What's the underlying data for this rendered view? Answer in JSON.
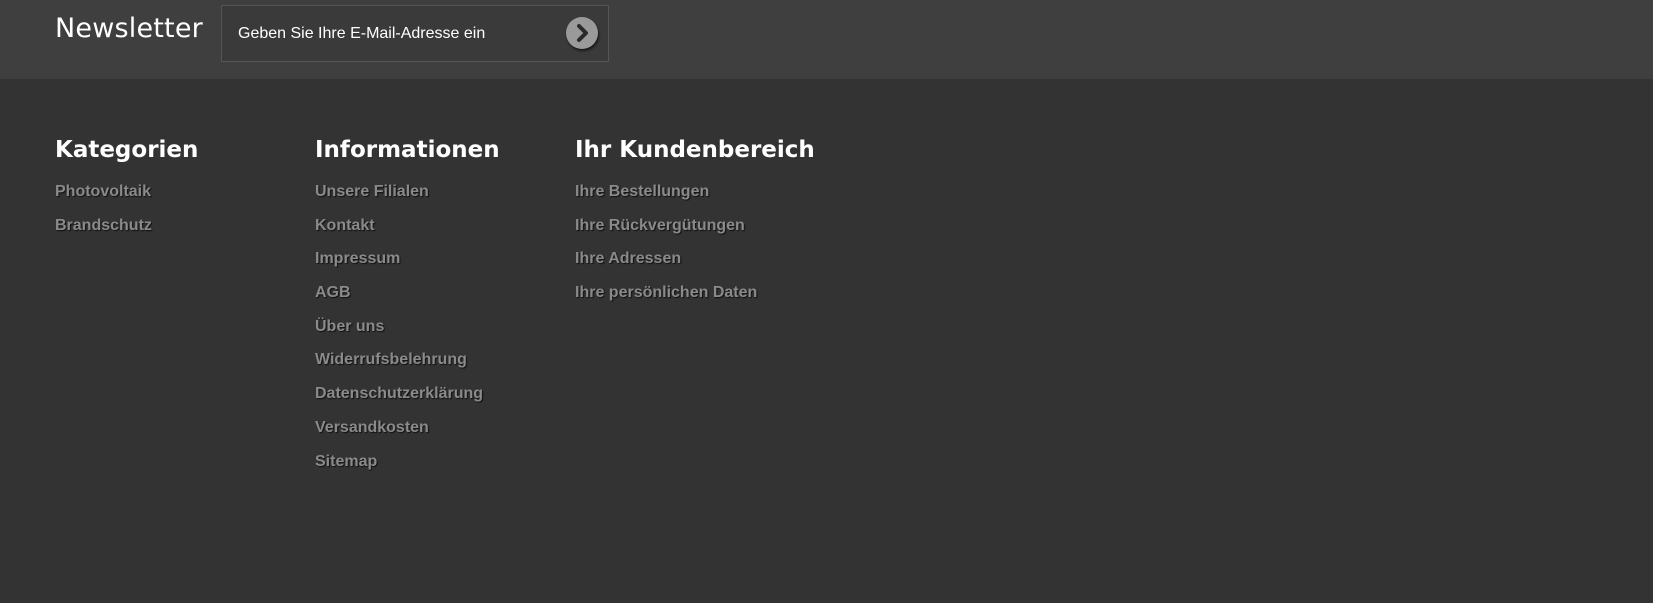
{
  "newsletter": {
    "title": "Newsletter",
    "email_placeholder": "Geben Sie Ihre E-Mail-Adresse ein",
    "submit_icon": "chevron-right-icon"
  },
  "footer": {
    "columns": [
      {
        "title": "Kategorien",
        "links": [
          "Photovoltaik",
          "Brandschutz"
        ]
      },
      {
        "title": "Informationen",
        "links": [
          "Unsere Filialen",
          "Kontakt",
          "Impressum",
          "AGB",
          "Über uns",
          "Widerrufsbelehrung",
          "Datenschutzerklärung",
          "Versandkosten",
          "Sitemap"
        ]
      },
      {
        "title": "Ihr Kundenbereich",
        "links": [
          "Ihre Bestellungen",
          "Ihre Rückvergütungen",
          "Ihre Adressen",
          "Ihre persönlichen Daten"
        ]
      }
    ]
  },
  "colors": {
    "page_background": "#333333",
    "newsletter_background": "#3f3f3f",
    "link_color": "#8a8a8a",
    "heading_color": "#ffffff",
    "button_color": "#9a9a9a"
  }
}
